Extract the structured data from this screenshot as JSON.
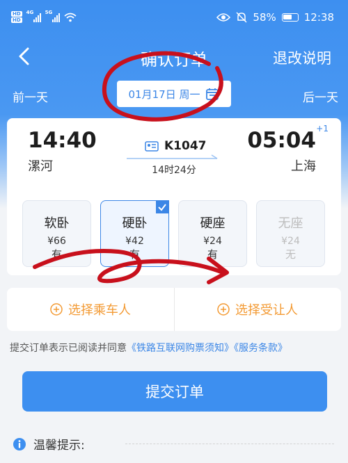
{
  "status_bar": {
    "hd_labels": [
      "HD",
      "HD"
    ],
    "network": [
      "4G",
      "5G"
    ],
    "battery": "58%",
    "time": "12:38",
    "icons": [
      "eye-icon",
      "bell-muted-icon",
      "wifi-icon",
      "battery-icon"
    ]
  },
  "nav": {
    "title": "确认订单",
    "right_label": "退改说明",
    "back_icon": "chevron-left-icon"
  },
  "date_bar": {
    "prev": "前一天",
    "next": "后一天",
    "date": "01月17日 周一"
  },
  "trip": {
    "depart_time": "14:40",
    "depart_station": "漯河",
    "arrive_time": "05:04",
    "arrive_station": "上海",
    "day_offset": "+1",
    "train_number": "K1047",
    "duration": "14时24分"
  },
  "seats": [
    {
      "name": "软卧",
      "price": "¥66",
      "availability": "有",
      "state": "normal"
    },
    {
      "name": "硬卧",
      "price": "¥42",
      "availability": "有",
      "state": "selected"
    },
    {
      "name": "硬座",
      "price": "¥24",
      "availability": "有",
      "state": "normal"
    },
    {
      "name": "无座",
      "price": "¥24",
      "availability": "无",
      "state": "disabled"
    }
  ],
  "passenger": {
    "select_passenger": "选择乘车人",
    "select_beneficiary": "选择受让人"
  },
  "agreement": {
    "prefix": "提交订单表示已阅读并同意",
    "link1": "《铁路互联网购票须知》",
    "link2": "《服务条款》"
  },
  "submit_label": "提交订单",
  "tips_label": "温馨提示:",
  "colors": {
    "primary": "#3d8ff0",
    "accent_orange": "#f39a33",
    "annotation_red": "#c8101c"
  }
}
